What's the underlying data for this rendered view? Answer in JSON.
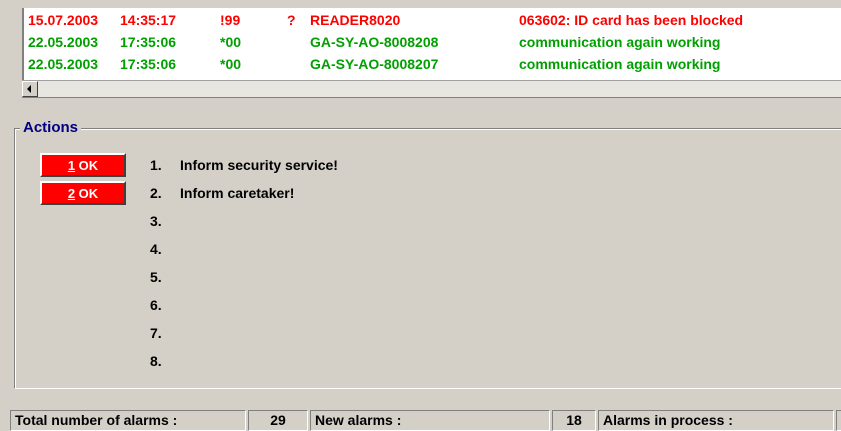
{
  "alarms": [
    {
      "date": "15.07.2003",
      "time": "14:35:17",
      "code": "!99",
      "flag": "?",
      "device": "READER8020",
      "message": "063602: ID card has been blocked",
      "color": "#ff0000"
    },
    {
      "date": "22.05.2003",
      "time": "17:35:06",
      "code": "*00",
      "flag": "",
      "device": "GA-SY-AO-8008208",
      "message": "communication again working",
      "color": "#00a000"
    },
    {
      "date": "22.05.2003",
      "time": "17:35:06",
      "code": "*00",
      "flag": "",
      "device": "GA-SY-AO-8008207",
      "message": "communication again working",
      "color": "#00a000"
    }
  ],
  "actions": {
    "legend": "Actions",
    "buttons": [
      {
        "key": "1",
        "label": " OK"
      },
      {
        "key": "2",
        "label": " OK"
      }
    ],
    "items": [
      {
        "num": "1.",
        "text": "Inform security service!"
      },
      {
        "num": "2.",
        "text": "Inform caretaker!"
      },
      {
        "num": "3.",
        "text": ""
      },
      {
        "num": "4.",
        "text": ""
      },
      {
        "num": "5.",
        "text": ""
      },
      {
        "num": "6.",
        "text": ""
      },
      {
        "num": "7.",
        "text": ""
      },
      {
        "num": "8.",
        "text": ""
      }
    ]
  },
  "status": {
    "total_label": "Total number of alarms :",
    "total_value": "29",
    "new_label": "New alarms :",
    "new_value": "18",
    "process_label": "Alarms in process :"
  },
  "colors": {
    "accent_legend": "#000080",
    "button_bg": "#ff0000",
    "alarm_red": "#ff0000",
    "alarm_green": "#00a000"
  }
}
